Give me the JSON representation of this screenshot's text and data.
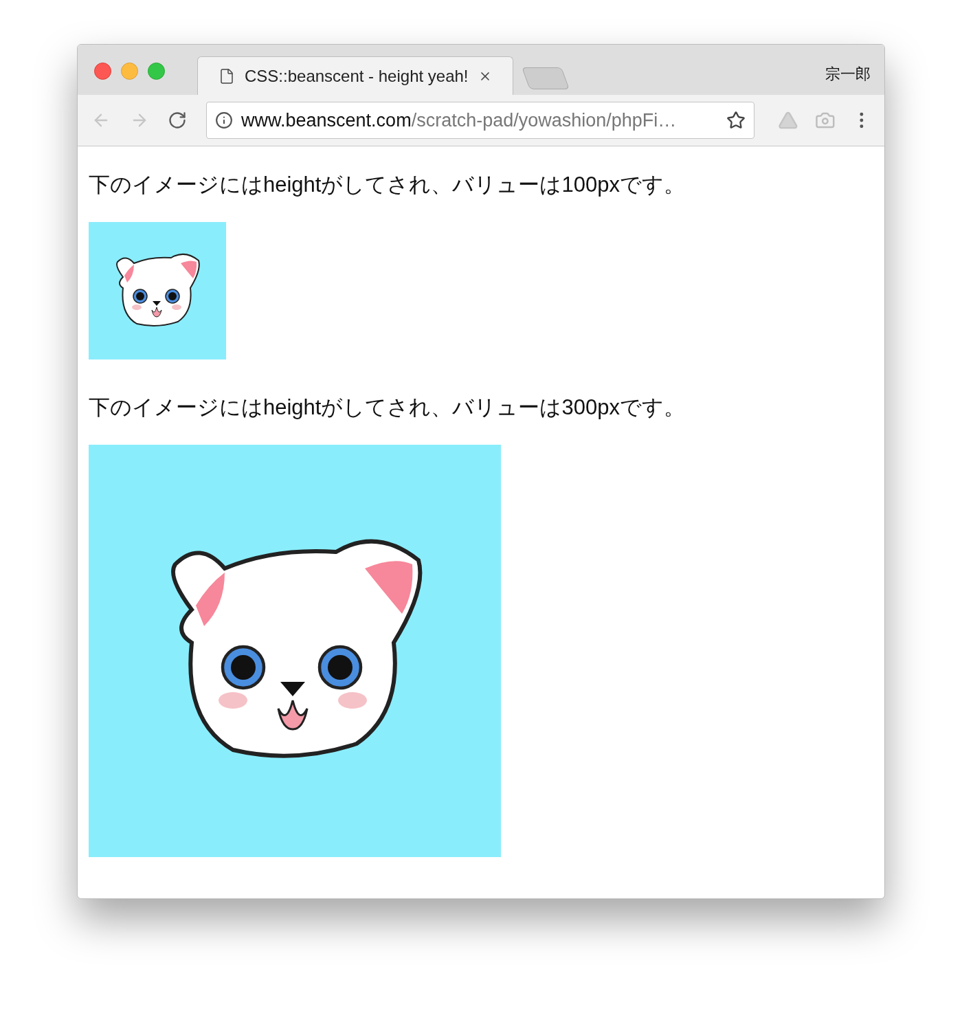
{
  "window": {
    "tabs": [
      {
        "label": "CSS::beanscent - height yeah!",
        "selected": true
      }
    ],
    "profile": "宗一郎"
  },
  "toolbar": {
    "nav": [
      {
        "kind": "back",
        "disabled": true
      },
      {
        "kind": "forward",
        "disabled": true
      },
      {
        "kind": "reload",
        "disabled": false
      }
    ],
    "address": {
      "domain": "www.beanscent.com",
      "path": "/scratch-pad/yowashion/phpFi…"
    }
  },
  "content": [
    {
      "kind": "text",
      "text": "下のイメージにはheightがしてされ、バリューは100pxです。"
    },
    {
      "kind": "thumbnail"
    },
    {
      "kind": "text",
      "text": "下のイメージにはheightがしてされ、バリューは300pxです。"
    },
    {
      "kind": "image"
    }
  ]
}
